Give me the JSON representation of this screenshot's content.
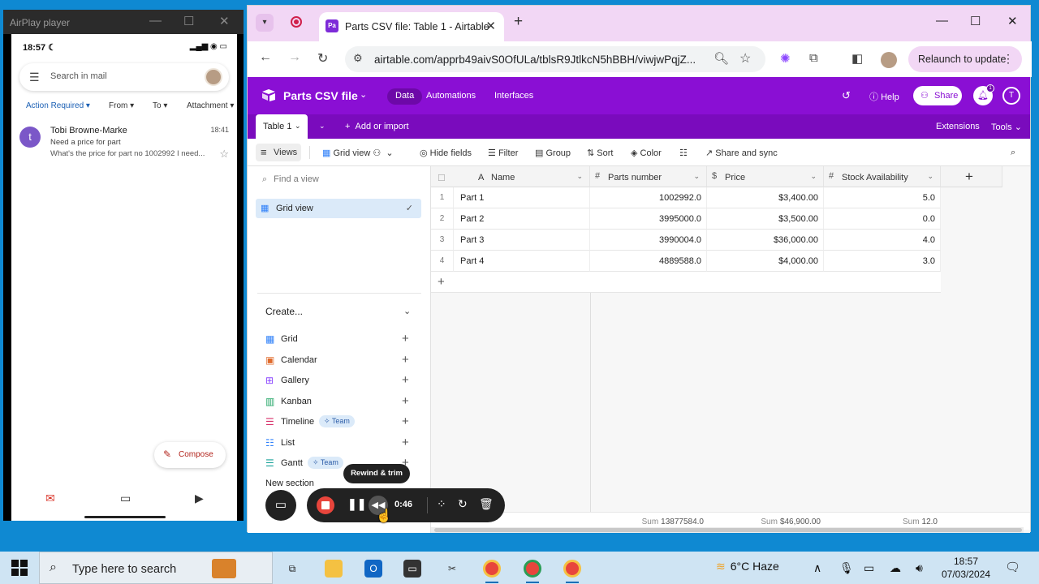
{
  "airplay": {
    "title": "AirPlay player",
    "phone_time": "18:57",
    "search_placeholder": "Search in mail",
    "chips": [
      "Action Required",
      "From",
      "To",
      "Attachment"
    ],
    "mail": {
      "avatar_letter": "t",
      "from": "Tobi Browne-Marke",
      "time": "18:41",
      "subject": "Need a price for part",
      "snippet": "What's the price for part no 1002992 I need..."
    },
    "compose_label": "Compose"
  },
  "chrome": {
    "tab_favicon": "Pa",
    "tab_title": "Parts CSV file: Table 1 - Airtable",
    "url": "airtable.com/apprb49aivS0OfULa/tblsR9JtlkcN5hBBH/viwjwPqjZ...",
    "relaunch_label": "Relaunch to update"
  },
  "airtable": {
    "base_name": "Parts CSV file",
    "nav": [
      "Data",
      "Automations",
      "Interfaces"
    ],
    "help": "Help",
    "share": "Share",
    "user_initial": "T",
    "bell_count": "1",
    "table_tab": "Table 1",
    "add_or_import": "Add or import",
    "extensions": "Extensions",
    "tools": "Tools",
    "viewbar": {
      "views": "Views",
      "grid_view": "Grid view",
      "hide_fields": "Hide fields",
      "filter": "Filter",
      "group": "Group",
      "sort": "Sort",
      "color": "Color",
      "share_sync": "Share and sync"
    },
    "find_view": "Find a view",
    "current_view": "Grid view",
    "create_heading": "Create...",
    "create_items": [
      {
        "label": "Grid",
        "icon": "grid-icon",
        "color": "#2d7ff9"
      },
      {
        "label": "Calendar",
        "icon": "calendar-icon",
        "color": "#e06b2c"
      },
      {
        "label": "Gallery",
        "icon": "gallery-icon",
        "color": "#8b46ff"
      },
      {
        "label": "Kanban",
        "icon": "kanban-icon",
        "color": "#20a464"
      },
      {
        "label": "Timeline",
        "icon": "timeline-icon",
        "color": "#d8306a",
        "badge": "Team"
      },
      {
        "label": "List",
        "icon": "list-icon",
        "color": "#2d7ff9"
      },
      {
        "label": "Gantt",
        "icon": "gantt-icon",
        "color": "#1aa39a",
        "badge": "Team"
      }
    ],
    "new_section": "New section",
    "columns": [
      "Name",
      "Parts number",
      "Price",
      "Stock Availability"
    ],
    "rows": [
      {
        "num": "1",
        "name": "Part 1",
        "parts_number": "1002992.0",
        "price": "$3,400.00",
        "stock": "5.0"
      },
      {
        "num": "2",
        "name": "Part 2",
        "parts_number": "3995000.0",
        "price": "$3,500.00",
        "stock": "0.0"
      },
      {
        "num": "3",
        "name": "Part 3",
        "parts_number": "3990004.0",
        "price": "$36,000.00",
        "stock": "4.0"
      },
      {
        "num": "4",
        "name": "Part 4",
        "parts_number": "4889588.0",
        "price": "$4,000.00",
        "stock": "3.0"
      }
    ],
    "sums": {
      "label": "Sum",
      "parts_number": "13877584.0",
      "price": "$46,900.00",
      "stock": "12.0"
    }
  },
  "recorder": {
    "time": "0:46",
    "tooltip": "Rewind & trim"
  },
  "taskbar": {
    "search_placeholder": "Type here to search",
    "weather": "6°C  Haze",
    "time": "18:57",
    "date": "07/03/2024"
  }
}
